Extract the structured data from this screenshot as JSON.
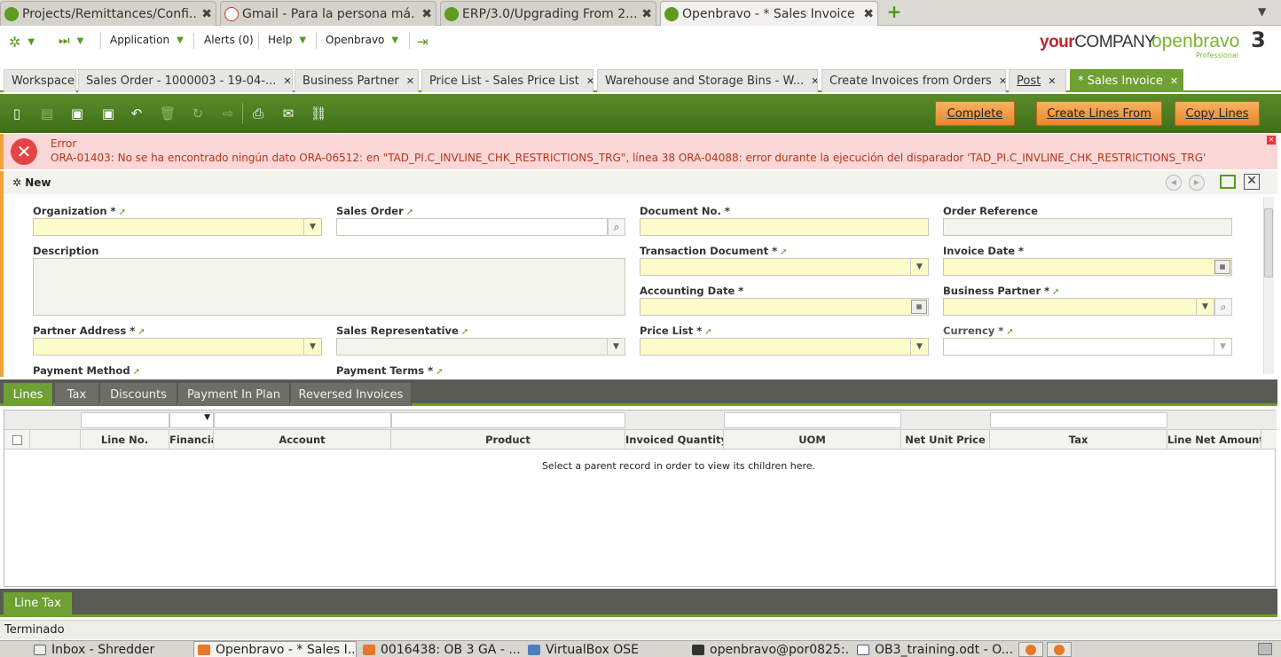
{
  "browser_tabs": [
    {
      "label": "Projects/Remittances/Confi...",
      "favicon": "openbravo"
    },
    {
      "label": "Gmail - Para la persona má...",
      "favicon": "gmail"
    },
    {
      "label": "ERP/3.0/Upgrading From 2....",
      "favicon": "openbravo"
    },
    {
      "label": "Openbravo - * Sales Invoice",
      "favicon": "openbravo",
      "active": true
    }
  ],
  "app_bar": {
    "menu": [
      "Application",
      "Alerts (0)",
      "Help",
      "Openbravo"
    ],
    "logo_company_prefix": "your",
    "logo_company_suffix": "COMPANY",
    "logo_openbravo": "openbravo",
    "logo_version": "3",
    "logo_edition": "Professional"
  },
  "app_tabs": [
    {
      "label": "Workspace",
      "closable": false
    },
    {
      "label": "Sales Order - 1000003 - 19-04-...",
      "closable": true
    },
    {
      "label": "Business Partner",
      "closable": true
    },
    {
      "label": "Price List - Sales Price List",
      "closable": true
    },
    {
      "label": "Warehouse and Storage Bins - W...",
      "closable": true
    },
    {
      "label": "Create Invoices from Orders",
      "closable": true
    },
    {
      "label": "Post",
      "closable": true
    },
    {
      "label": "* Sales Invoice",
      "closable": true,
      "active": true
    }
  ],
  "toolbar": {
    "buttons": [
      "Complete",
      "Create Lines From",
      "Copy Lines"
    ],
    "icons": [
      "new-document-icon",
      "grid-icon",
      "save-icon",
      "save-close-icon",
      "undo-icon",
      "delete-icon",
      "refresh-icon",
      "export-icon",
      "print-icon",
      "email-icon",
      "link-icon"
    ]
  },
  "error": {
    "title": "Error",
    "message": "ORA-01403: No se ha encontrado ningún dato ORA-06512: en \"TAD_PI.C_INVLINE_CHK_RESTRICTIONS_TRG\", línea 38 ORA-04088: error durante la ejecución del disparador 'TAD_PI.C_INVLINE_CHK_RESTRICTIONS_TRG'"
  },
  "form": {
    "mode": "New",
    "fields": {
      "organization": {
        "label": "Organization *",
        "value": ""
      },
      "sales_order": {
        "label": "Sales Order",
        "value": ""
      },
      "document_no": {
        "label": "Document No. *",
        "value": ""
      },
      "order_reference": {
        "label": "Order Reference",
        "value": ""
      },
      "description": {
        "label": "Description",
        "value": ""
      },
      "transaction_document": {
        "label": "Transaction Document *",
        "value": ""
      },
      "invoice_date": {
        "label": "Invoice Date *",
        "value": ""
      },
      "accounting_date": {
        "label": "Accounting Date *",
        "value": ""
      },
      "business_partner": {
        "label": "Business Partner *",
        "value": ""
      },
      "partner_address": {
        "label": "Partner Address *",
        "value": ""
      },
      "sales_representative": {
        "label": "Sales Representative",
        "value": ""
      },
      "price_list": {
        "label": "Price List *",
        "value": ""
      },
      "currency": {
        "label": "Currency *",
        "value": ""
      },
      "payment_method": {
        "label": "Payment Method",
        "value": ""
      },
      "payment_terms": {
        "label": "Payment Terms *",
        "value": ""
      }
    }
  },
  "child_tabs": [
    "Lines",
    "Tax",
    "Discounts",
    "Payment In Plan",
    "Reversed Invoices"
  ],
  "grid": {
    "columns": [
      "Line No.",
      "Financia",
      "Account",
      "Product",
      "Invoiced Quantity",
      "UOM",
      "Net Unit Price",
      "Tax",
      "Line Net Amount"
    ],
    "empty_message": "Select a parent record in order to view its children here."
  },
  "line_tax_tab": "Line Tax",
  "status_text": "Terminado",
  "taskbar": [
    {
      "label": "Inbox - Shredder",
      "icon": "mail"
    },
    {
      "label": "Openbravo - * Sales I...",
      "icon": "firefox",
      "active": true
    },
    {
      "label": "0016438: OB 3 GA - ...",
      "icon": "firefox"
    },
    {
      "label": "VirtualBox OSE",
      "icon": "virtualbox"
    },
    {
      "label": "openbravo@por0825:...",
      "icon": "terminal"
    },
    {
      "label": "OB3_training.odt - O...",
      "icon": "document"
    }
  ]
}
